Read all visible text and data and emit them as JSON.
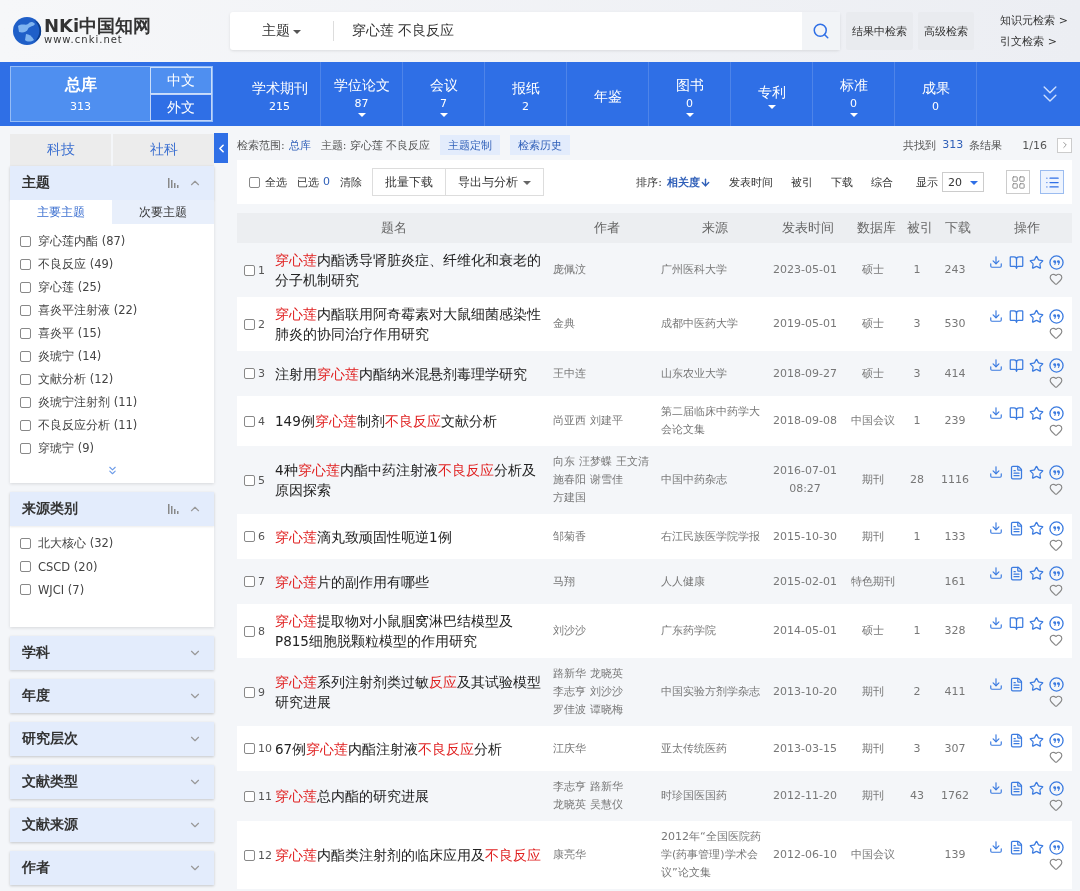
{
  "header": {
    "logo": "NKi中国知网",
    "logo_url": "www.cnki.net",
    "search": {
      "field": "主题",
      "query": "穿心莲 不良反应"
    },
    "buttons": [
      "结果中检索",
      "高级检索"
    ],
    "links": [
      "知识元检索 >",
      "引文检索 >"
    ]
  },
  "nav": {
    "tabs": [
      {
        "label": "总库",
        "count": "313",
        "selected": true,
        "languages": [
          "中文",
          "外文"
        ]
      },
      {
        "label": "学术期刊",
        "count": "215",
        "selected": false,
        "expandable": false
      },
      {
        "label": "学位论文",
        "count": "87",
        "selected": false,
        "expandable": true
      },
      {
        "label": "会议",
        "count": "7",
        "selected": false,
        "expandable": true
      },
      {
        "label": "报纸",
        "count": "2",
        "selected": false,
        "expandable": false
      },
      {
        "label": "年鉴",
        "selected": false,
        "expandable": false
      },
      {
        "label": "图书",
        "count": "0",
        "selected": false,
        "expandable": true
      },
      {
        "label": "专利",
        "selected": false,
        "expandable": true
      },
      {
        "label": "标准",
        "count": "0",
        "selected": false,
        "expandable": true
      },
      {
        "label": "成果",
        "count": "0",
        "selected": false,
        "expandable": false
      }
    ]
  },
  "sidebar": {
    "categories": [
      "科技",
      "社科"
    ],
    "groups": [
      {
        "title": "主题",
        "expanded": true,
        "more": true,
        "subtabs": [
          {
            "label": "主要主题",
            "selected": true
          },
          {
            "label": "次要主题",
            "selected": false
          }
        ],
        "items": [
          {
            "label": "穿心莲内酯 (87)",
            "checked": false
          },
          {
            "label": "不良反应 (49)",
            "checked": false
          },
          {
            "label": "穿心莲 (25)",
            "checked": false
          },
          {
            "label": "喜炎平注射液 (22)",
            "checked": false
          },
          {
            "label": "喜炎平 (15)",
            "checked": false
          },
          {
            "label": "炎琥宁 (14)",
            "checked": false
          },
          {
            "label": "文献分析 (12)",
            "checked": false
          },
          {
            "label": "炎琥宁注射剂 (11)",
            "checked": false
          },
          {
            "label": "不良反应分析 (11)",
            "checked": false
          },
          {
            "label": "穿琥宁 (9)",
            "checked": false
          }
        ]
      },
      {
        "title": "来源类别",
        "expanded": true,
        "more": false,
        "items": [
          {
            "label": "北大核心 (32)",
            "checked": false
          },
          {
            "label": "CSCD (20)",
            "checked": false
          },
          {
            "label": "WJCI (7)",
            "checked": false
          }
        ]
      },
      {
        "title": "学科",
        "expanded": false
      },
      {
        "title": "年度",
        "expanded": false
      },
      {
        "title": "研究层次",
        "expanded": false
      },
      {
        "title": "文献类型",
        "expanded": false
      },
      {
        "title": "文献来源",
        "expanded": false
      },
      {
        "title": "作者",
        "expanded": false
      }
    ]
  },
  "results": {
    "scope_label": "检索范围:",
    "scope": "总库",
    "topic": "主题: 穿心莲 不良反应",
    "tags": [
      "主题定制",
      "检索历史"
    ],
    "found": [
      "共找到",
      "313",
      "条结果"
    ],
    "page": "1/16",
    "select_all": {
      "label": "全选",
      "checked": false
    },
    "selected_label": "已选",
    "selected_count": "0",
    "clear": "清除",
    "actions": [
      {
        "label": "批量下载",
        "dropdown": false
      },
      {
        "label": "导出与分析",
        "dropdown": true
      }
    ],
    "sort_label": "排序:",
    "sort": [
      {
        "label": "相关度",
        "selected": true
      },
      {
        "label": "发表时间",
        "selected": false
      },
      {
        "label": "被引",
        "selected": false
      },
      {
        "label": "下载",
        "selected": false
      },
      {
        "label": "综合",
        "selected": false
      }
    ],
    "show_label": "显示",
    "page_size": "20",
    "views": [
      {
        "kind": "grid",
        "selected": false
      },
      {
        "kind": "list",
        "selected": true
      }
    ],
    "columns": [
      "题名",
      "作者",
      "来源",
      "发表时间",
      "数据库",
      "被引",
      "下载",
      "操作"
    ],
    "rows": [
      {
        "index": "1",
        "checked": false,
        "kind": "book",
        "title": [
          {
            "text": "穿心莲",
            "highlight": true
          },
          {
            "text": "内酯诱导肾脏炎症、纤维化和衰老的分子机制研究",
            "highlight": false
          }
        ],
        "authors": [
          "庞佩汶"
        ],
        "source": "广州医科大学",
        "date": "2023-05-01",
        "database": "硕士",
        "cited": "1",
        "downloads": "243"
      },
      {
        "index": "2",
        "checked": false,
        "kind": "book",
        "title": [
          {
            "text": "穿心莲",
            "highlight": true
          },
          {
            "text": "内酯联用阿奇霉素对大鼠细菌感染性肺炎的协同治疗作用研究",
            "highlight": false
          }
        ],
        "authors": [
          "金典"
        ],
        "source": "成都中医药大学",
        "date": "2019-05-01",
        "database": "硕士",
        "cited": "3",
        "downloads": "530"
      },
      {
        "index": "3",
        "checked": false,
        "kind": "book",
        "title": [
          {
            "text": "注射用",
            "highlight": false
          },
          {
            "text": "穿心莲",
            "highlight": true
          },
          {
            "text": "内酯纳米混悬剂毒理学研究",
            "highlight": false
          }
        ],
        "authors": [
          "王中连"
        ],
        "source": "山东农业大学",
        "date": "2018-09-27",
        "database": "硕士",
        "cited": "3",
        "downloads": "414"
      },
      {
        "index": "4",
        "checked": false,
        "kind": "book",
        "title": [
          {
            "text": "149例",
            "highlight": false
          },
          {
            "text": "穿心莲",
            "highlight": true
          },
          {
            "text": "制剂",
            "highlight": false
          },
          {
            "text": "不良反应",
            "highlight": true
          },
          {
            "text": "文献分析",
            "highlight": false
          }
        ],
        "authors": [
          "尚亚西",
          "刘建平"
        ],
        "source": "第二届临床中药学大会论文集",
        "date": "2018-09-08",
        "database": "中国会议",
        "cited": "1",
        "downloads": "239"
      },
      {
        "index": "5",
        "checked": false,
        "kind": "page",
        "title": [
          {
            "text": "4种",
            "highlight": false
          },
          {
            "text": "穿心莲",
            "highlight": true
          },
          {
            "text": "内酯中药注射液",
            "highlight": false
          },
          {
            "text": "不良反应",
            "highlight": true
          },
          {
            "text": "分析及原因探索",
            "highlight": false
          }
        ],
        "authors": [
          "向东",
          "汪梦蝶",
          "王文清",
          "施春阳",
          "谢雪佳",
          "方建国"
        ],
        "source": "中国中药杂志",
        "date": "2016-07-01 08:27",
        "database": "期刊",
        "cited": "28",
        "downloads": "1116"
      },
      {
        "index": "6",
        "checked": false,
        "kind": "page",
        "title": [
          {
            "text": "穿心莲",
            "highlight": true
          },
          {
            "text": "滴丸致顽固性呃逆1例",
            "highlight": false
          }
        ],
        "authors": [
          "邹菊香"
        ],
        "source": "右江民族医学院学报",
        "date": "2015-10-30",
        "database": "期刊",
        "cited": "1",
        "downloads": "133"
      },
      {
        "index": "7",
        "checked": false,
        "kind": "page",
        "title": [
          {
            "text": "穿心莲",
            "highlight": true
          },
          {
            "text": "片的副作用有哪些",
            "highlight": false
          }
        ],
        "authors": [
          "马翔"
        ],
        "source": "人人健康",
        "date": "2015-02-01",
        "database": "特色期刊",
        "downloads": "161"
      },
      {
        "index": "8",
        "checked": false,
        "kind": "book",
        "title": [
          {
            "text": "穿心莲",
            "highlight": true
          },
          {
            "text": "提取物对小鼠腘窝淋巴结模型及P815细胞脱颗粒模型的作用研究",
            "highlight": false
          }
        ],
        "authors": [
          "刘沙沙"
        ],
        "source": "广东药学院",
        "date": "2014-05-01",
        "database": "硕士",
        "cited": "1",
        "downloads": "328"
      },
      {
        "index": "9",
        "checked": false,
        "kind": "page",
        "title": [
          {
            "text": "穿心莲",
            "highlight": true
          },
          {
            "text": "系列注射剂类过敏",
            "highlight": false
          },
          {
            "text": "反应",
            "highlight": true
          },
          {
            "text": "及其试验模型研究进展",
            "highlight": false
          }
        ],
        "authors": [
          "路新华",
          "龙晓英",
          "李志亨",
          "刘沙沙",
          "罗佳波",
          "谭晓梅"
        ],
        "source": "中国实验方剂学杂志",
        "date": "2013-10-20",
        "database": "期刊",
        "cited": "2",
        "downloads": "411"
      },
      {
        "index": "10",
        "checked": false,
        "kind": "page",
        "title": [
          {
            "text": "67例",
            "highlight": false
          },
          {
            "text": "穿心莲",
            "highlight": true
          },
          {
            "text": "内酯注射液",
            "highlight": false
          },
          {
            "text": "不良反应",
            "highlight": true
          },
          {
            "text": "分析",
            "highlight": false
          }
        ],
        "authors": [
          "江庆华"
        ],
        "source": "亚太传统医药",
        "date": "2013-03-15",
        "database": "期刊",
        "cited": "3",
        "downloads": "307"
      },
      {
        "index": "11",
        "checked": false,
        "kind": "page",
        "title": [
          {
            "text": "穿心莲",
            "highlight": true
          },
          {
            "text": "总内酯的研究进展",
            "highlight": false
          }
        ],
        "authors": [
          "李志亨",
          "路新华",
          "龙晓英",
          "吴慧仪"
        ],
        "source": "时珍国医国药",
        "date": "2012-11-20",
        "database": "期刊",
        "cited": "43",
        "downloads": "1762"
      },
      {
        "index": "12",
        "checked": false,
        "kind": "page",
        "title": [
          {
            "text": "穿心莲",
            "highlight": true
          },
          {
            "text": "内酯类注射剂的临床应用及",
            "highlight": false
          },
          {
            "text": "不良反应",
            "highlight": true
          }
        ],
        "authors": [
          "康亮华"
        ],
        "source": "2012年“全国医院药学(药事管理)学术会议”论文集",
        "date": "2012-06-10",
        "database": "中国会议",
        "downloads": "139"
      }
    ]
  }
}
